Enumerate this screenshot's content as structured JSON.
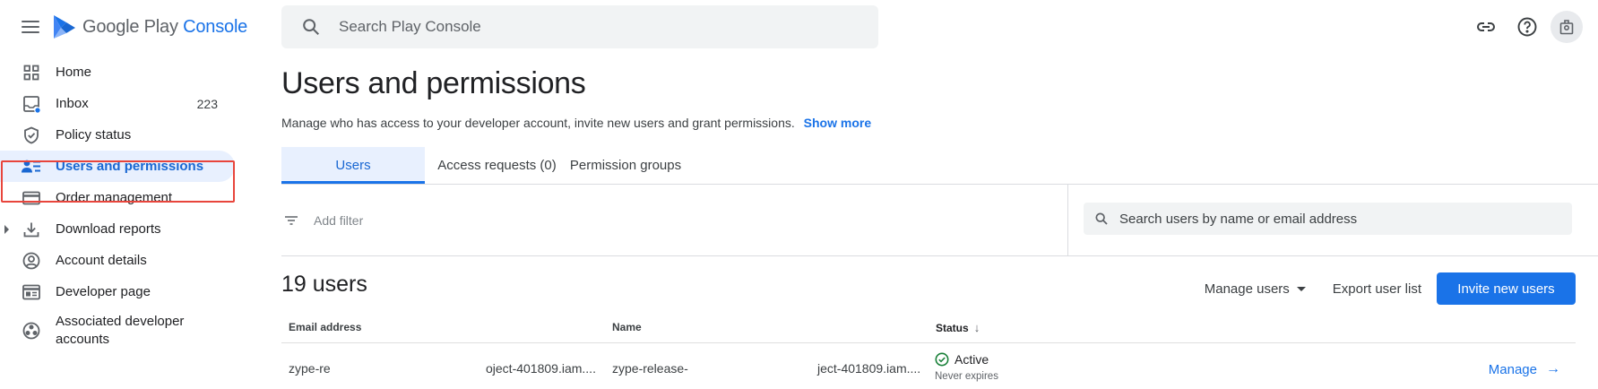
{
  "app": {
    "brand_part1": "Google Play",
    "brand_part2": "Console"
  },
  "colors": {
    "accent": "#1a73e8",
    "active_bg": "#e8f0fe",
    "highlight_border": "#e8453c",
    "status_active": "#188038"
  },
  "sidebar": {
    "items": [
      {
        "label": "Home",
        "icon": "home-grid-icon"
      },
      {
        "label": "Inbox",
        "icon": "inbox-icon",
        "count": "223"
      },
      {
        "label": "Policy status",
        "icon": "shield-check-icon"
      },
      {
        "label": "Users and permissions",
        "icon": "users-list-icon",
        "active": true
      },
      {
        "label": "Order management",
        "icon": "credit-card-icon"
      },
      {
        "label": "Download reports",
        "icon": "download-icon"
      },
      {
        "label": "Account details",
        "icon": "account-circle-icon"
      },
      {
        "label": "Developer page",
        "icon": "web-page-icon"
      },
      {
        "label": "Associated developer accounts",
        "icon": "linked-accounts-icon"
      }
    ]
  },
  "topbar": {
    "search_placeholder": "Search Play Console",
    "icons": [
      "link-icon",
      "help-icon",
      "account-avatar-icon"
    ]
  },
  "main": {
    "title": "Users and permissions",
    "description": "Manage who has access to your developer account, invite new users and grant permissions.",
    "show_more": "Show more",
    "tabs": [
      {
        "label": "Users",
        "active": true
      },
      {
        "label": "Access requests (0)"
      },
      {
        "label": "Permission groups"
      }
    ],
    "filter_label": "Add filter",
    "user_search_placeholder": "Search users by name or email address",
    "user_count": "19 users",
    "actions": {
      "manage_users": "Manage users",
      "export": "Export user list",
      "invite": "Invite new users"
    },
    "table": {
      "headers": {
        "email": "Email address",
        "name": "Name",
        "status": "Status"
      },
      "rows": [
        {
          "email_start": "zype-re",
          "email_end": "oject-401809.iam....",
          "name_start": "zype-release-",
          "name_end": "ject-401809.iam....",
          "status": "Active",
          "status_sub": "Never expires",
          "action": "Manage"
        }
      ]
    }
  }
}
